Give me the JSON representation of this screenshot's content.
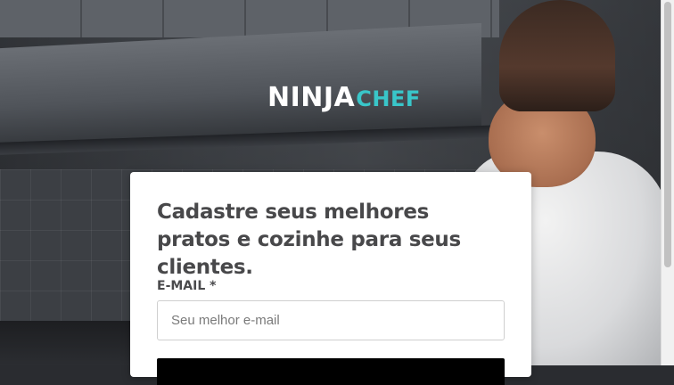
{
  "logo": {
    "part1": "NINJA",
    "part2": "CHEF",
    "colors": {
      "primary": "#ffffff",
      "accent": "#39c6c9"
    }
  },
  "signup_card": {
    "heading": "Cadastre seus melhores pratos e cozinhe para seus clientes.",
    "email_label": "E-MAIL *",
    "email_value": "",
    "email_placeholder": "Seu melhor e-mail",
    "submit_button_color": "#000000"
  },
  "background": {
    "icon": "chef-in-kitchen-photo"
  }
}
